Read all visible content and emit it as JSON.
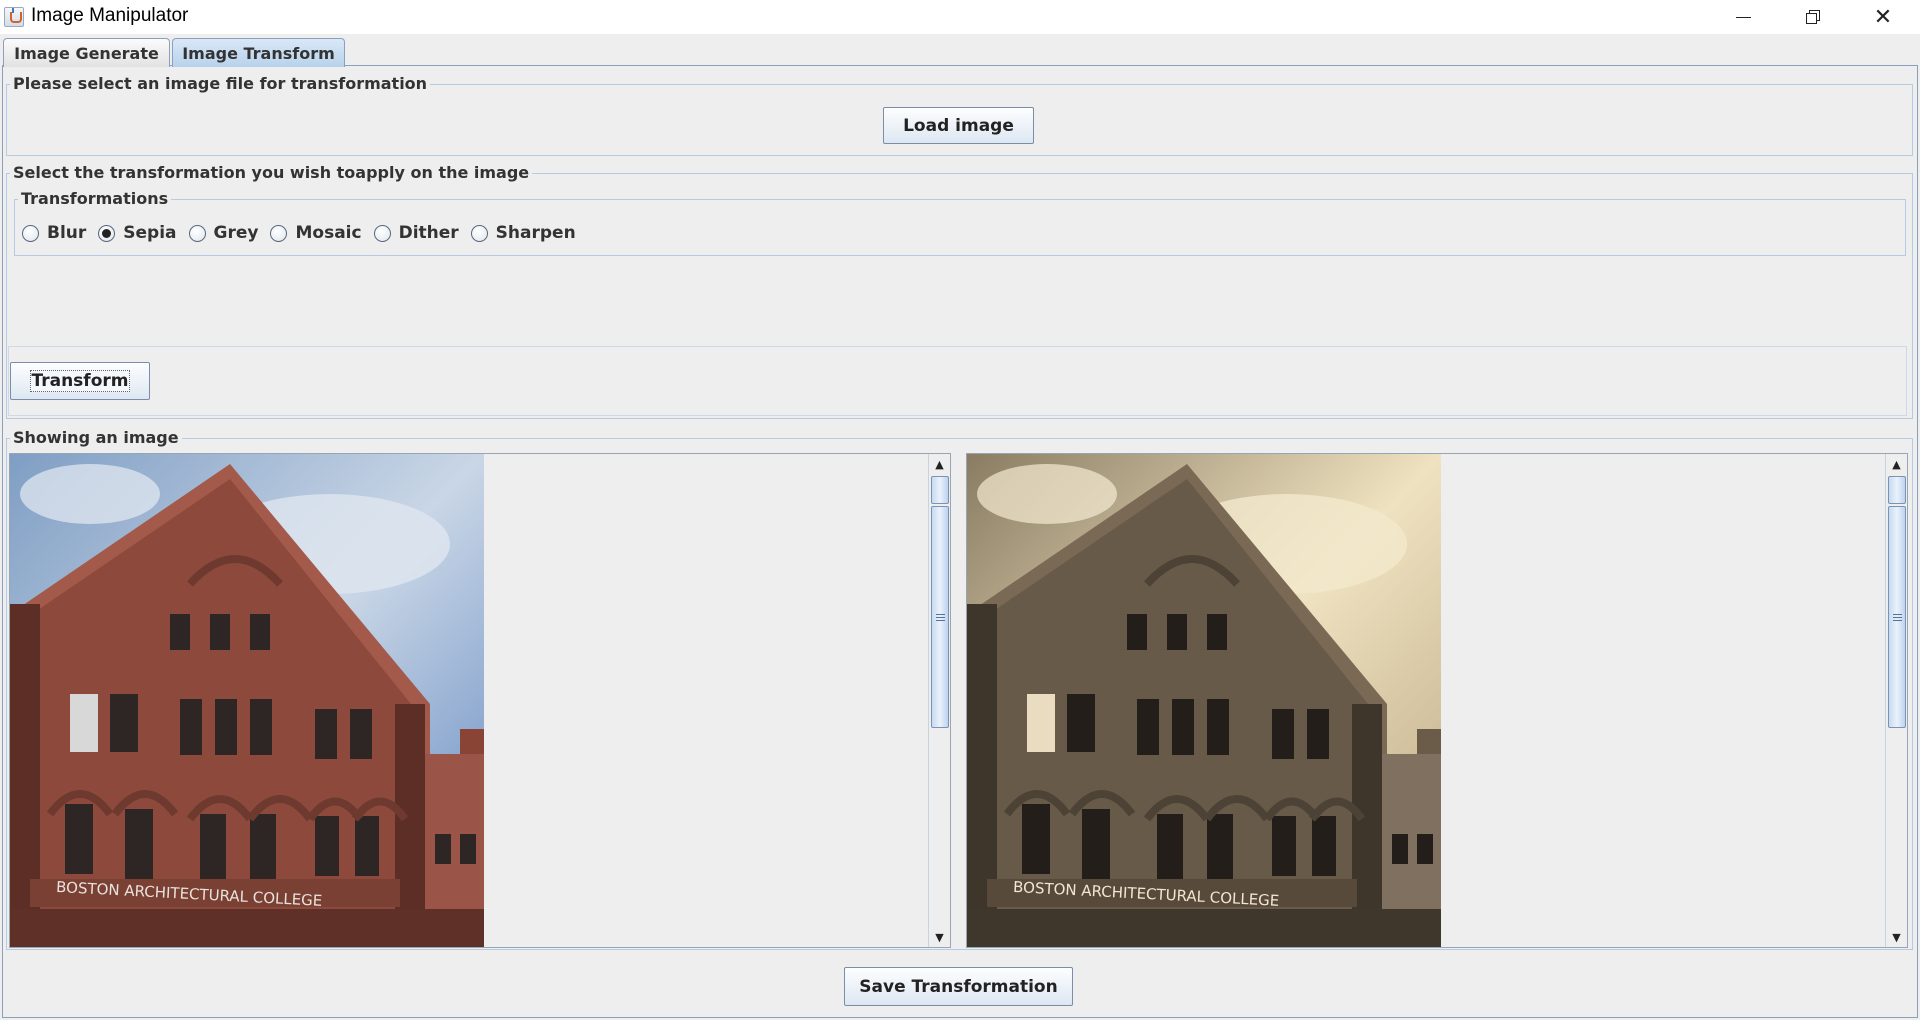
{
  "window": {
    "title": "Image Manipulator",
    "controls": {
      "minimize": "minimize-icon",
      "restore": "restore-icon",
      "close": "✕"
    }
  },
  "tabs": [
    {
      "label": "Image Generate",
      "selected": false
    },
    {
      "label": "Image Transform",
      "selected": true
    }
  ],
  "file_section": {
    "title": "Please select an image file for transformation",
    "load_button": "Load image"
  },
  "transform_section": {
    "title": "Select the transformation you wish toapply on the image",
    "group_title": "Transformations",
    "options": [
      {
        "label": "Blur",
        "checked": false
      },
      {
        "label": "Sepia",
        "checked": true
      },
      {
        "label": "Grey",
        "checked": false
      },
      {
        "label": "Mosaic",
        "checked": false
      },
      {
        "label": "Dither",
        "checked": false
      },
      {
        "label": "Sharpen",
        "checked": false
      }
    ],
    "transform_button": "Transform"
  },
  "image_section": {
    "title": "Showing an image",
    "original_image": {
      "sign_text": "BOSTON ARCHITECTURAL COLLEGE",
      "filter": "none"
    },
    "transformed_image": {
      "sign_text": "BOSTON ARCHITECTURAL COLLEGE",
      "filter": "sepia"
    }
  },
  "footer": {
    "save_button": "Save Transformation"
  },
  "colors": {
    "accent_border": "#b5cbe3",
    "selected_tab": "#b8d2ec",
    "background": "#eeeeee"
  }
}
